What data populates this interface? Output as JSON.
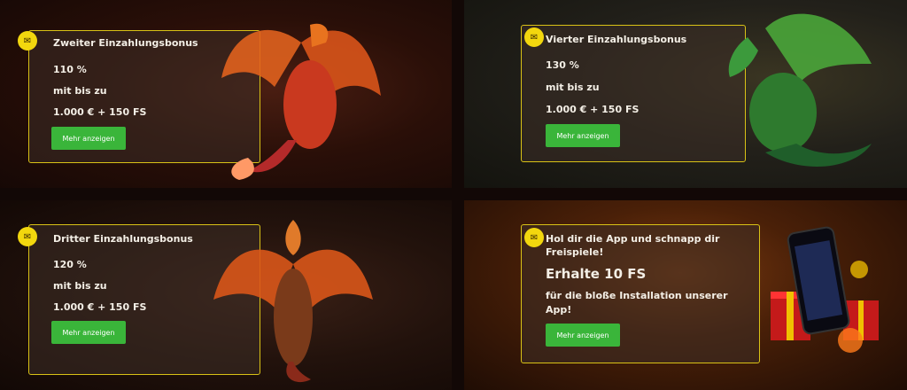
{
  "panels": [
    {
      "title": "Zweiter Einzahlungsbonus",
      "percent": "110 %",
      "upto": "mit bis zu",
      "amount": "1.000 € + 150 FS",
      "button": "Mehr anzeigen",
      "art": "red-dragon"
    },
    {
      "title": "Vierter Einzahlungsbonus",
      "percent": "130 %",
      "upto": "mit bis zu",
      "amount": "1.000 € + 150 FS",
      "button": "Mehr anzeigen",
      "art": "green-dragon"
    },
    {
      "title": "Dritter Einzahlungsbonus",
      "percent": "120 %",
      "upto": "mit bis zu",
      "amount": "1.000 € + 150 FS",
      "button": "Mehr anzeigen",
      "art": "orange-dragon"
    },
    {
      "title": "Hol dir die App und schnapp dir Freispiele!",
      "headline": "Erhalte 10 FS",
      "subtext": "für die bloße Installation unserer App!",
      "button": "Mehr anzeigen",
      "art": "phone-and-gifts"
    }
  ],
  "colors": {
    "accent_yellow": "#d9c216",
    "button_green": "#3ab53a",
    "badge_yellow": "#f2d70e"
  },
  "icons": {
    "badge": "megaphone-icon"
  }
}
